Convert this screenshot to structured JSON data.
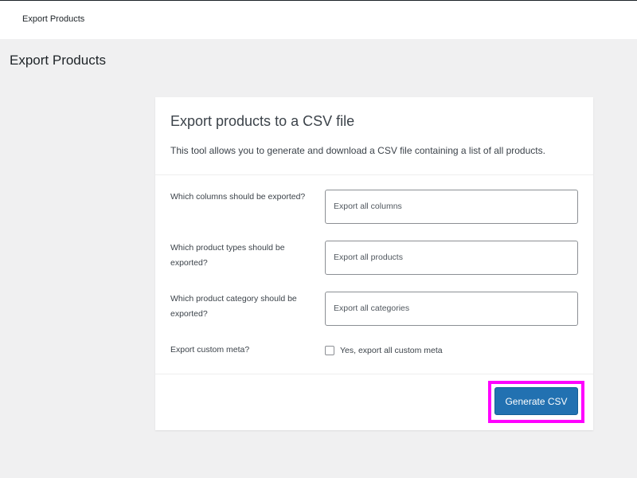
{
  "topbar": {
    "title": "Export Products"
  },
  "page": {
    "title": "Export Products"
  },
  "card": {
    "heading": "Export products to a CSV file",
    "description": "This tool allows you to generate and download a CSV file containing a list of all products.",
    "fields": [
      {
        "label": "Which columns should be exported?",
        "value": "Export all columns"
      },
      {
        "label": "Which product types should be exported?",
        "value": "Export all products"
      },
      {
        "label": "Which product category should be exported?",
        "value": "Export all categories"
      }
    ],
    "custom_meta": {
      "label": "Export custom meta?",
      "checkbox_label": "Yes, export all custom meta",
      "checked": false
    },
    "button_label": "Generate CSV"
  },
  "colors": {
    "accent": "#2271b1",
    "highlight": "#ff00ff",
    "background": "#f0f0f1"
  }
}
